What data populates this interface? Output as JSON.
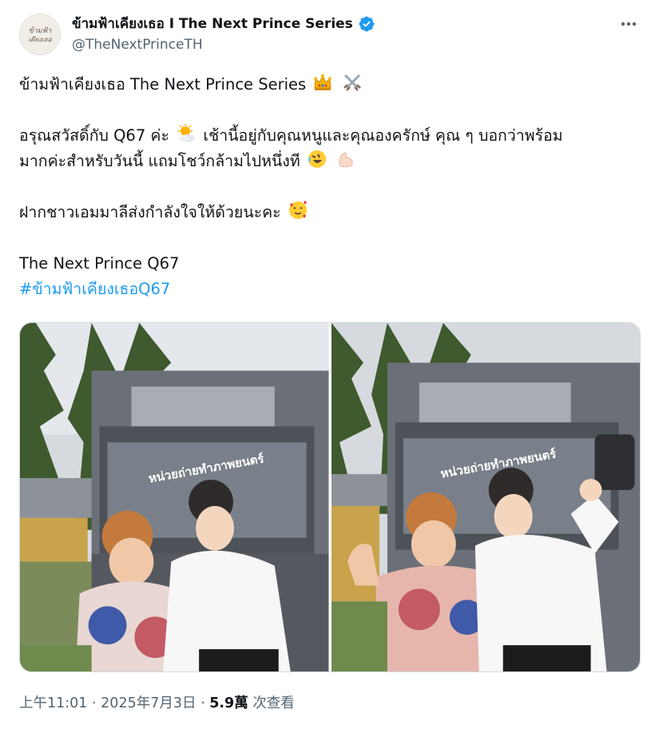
{
  "account": {
    "display_name": "ข้ามฟ้าเคียงเธอ I The Next Prince Series",
    "handle": "@TheNextPrinceTH",
    "avatar_text": "ข้ามฟ้าเคียงเธอ",
    "verified_color": "#1d9bf0"
  },
  "tweet": {
    "line1": "ข้ามฟ้าเคียงเธอ The Next Prince Series",
    "line1_icons": [
      "crown-emoji",
      "crossed-swords-emoji"
    ],
    "line2a": "อรุณสวัสดิ์กับ Q67 ค่ะ",
    "line2a_icon": "sun-behind-cloud-emoji",
    "line2b": "เช้านี้อยู่กับคุณหนูและคุณองครักษ์ คุณ ๆ บอกว่าพร้อม",
    "line3": "มากค่ะสำหรับวันนี้ แถมโชว์กล้ามไปหนึ่งที",
    "line3_icons": [
      "rolling-laughing-emoji",
      "flexed-biceps-emoji"
    ],
    "line4": "ฝากชาวเอมมาลีส่งกำลังใจให้ด้วยนะคะ",
    "line4_icon": "smiling-hearts-emoji",
    "line5": "The Next Prince Q67",
    "hashtag": "#ข้ามฟ้าเคียงเธอQ67"
  },
  "media": {
    "photos": [
      {
        "truck_sign": "หน่วยถ่ายทำภาพยนตร์"
      },
      {
        "truck_sign": "หน่วยถ่ายทำภาพยนตร์"
      }
    ]
  },
  "meta": {
    "time": "上午11:01",
    "date": "2025年7月3日",
    "separator": "·",
    "views_count": "5.9萬",
    "views_label": "次查看"
  },
  "colors": {
    "link": "#1d9bf0",
    "secondary": "#536471",
    "text": "#0f1419"
  }
}
